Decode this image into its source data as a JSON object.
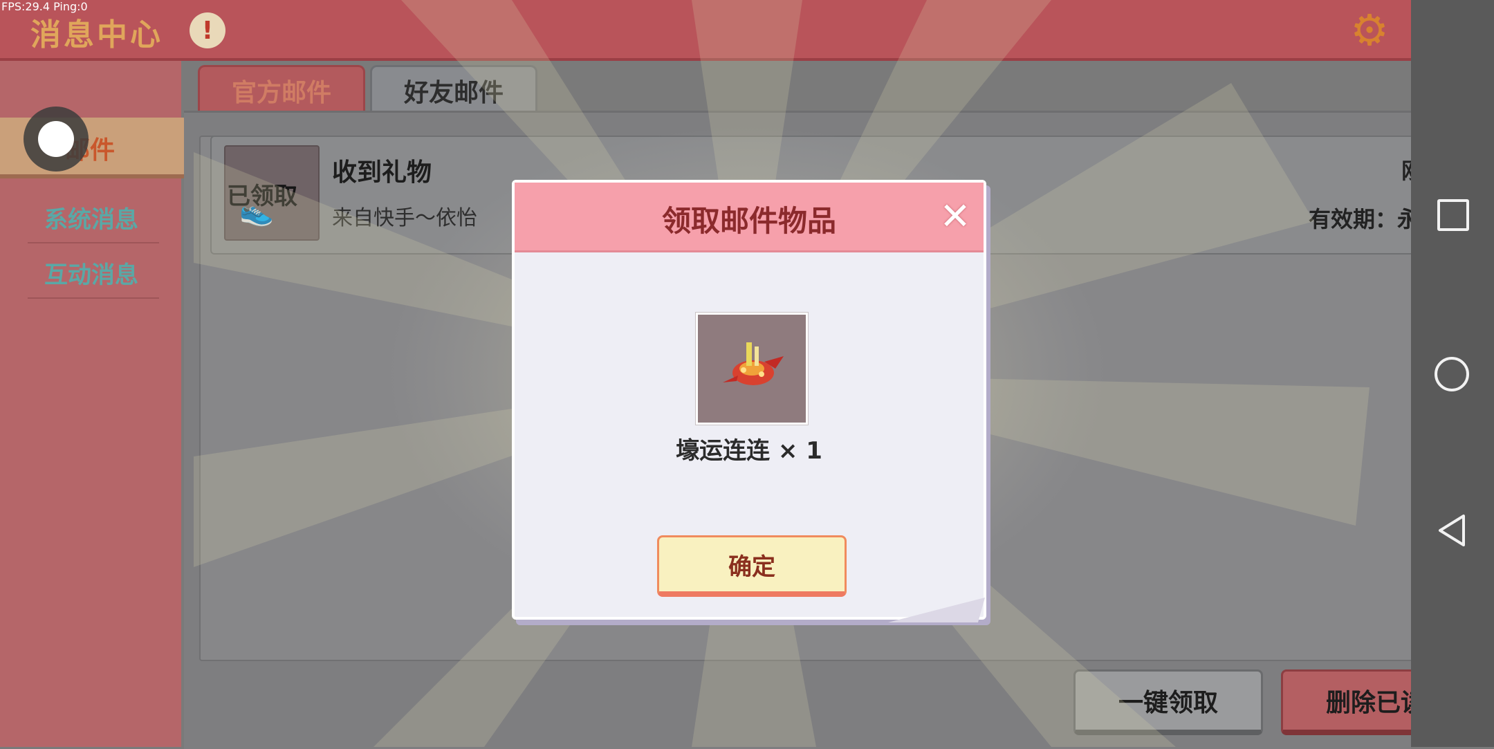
{
  "overlay": {
    "fps": "FPS:29.4  Ping:0"
  },
  "header": {
    "title": "消息中心",
    "alert_glyph": "!",
    "settings_icon": "gear-icon",
    "close_glyph": "✕"
  },
  "leftnav": {
    "active_label": "邮件",
    "items": [
      {
        "label": "系统消息"
      },
      {
        "label": "互动消息"
      }
    ]
  },
  "tabs": [
    {
      "label": "官方邮件"
    },
    {
      "label": "好友邮件"
    }
  ],
  "mail": {
    "title": "收到礼物",
    "from": "来自快手～依怡",
    "time": "刚刚",
    "validity": "有效期：永久",
    "status": "已领取"
  },
  "buttons": {
    "claim_all": "一键领取",
    "delete_read": "删除已读"
  },
  "dialog": {
    "title": "领取邮件物品",
    "item_label": "壕运连连 × 1",
    "confirm": "确定",
    "close_glyph": "✕"
  },
  "colors": {
    "dialog_header": "#f6a0ab",
    "confirm_button": "#f9f1c0",
    "delete_button": "#b45f62"
  }
}
